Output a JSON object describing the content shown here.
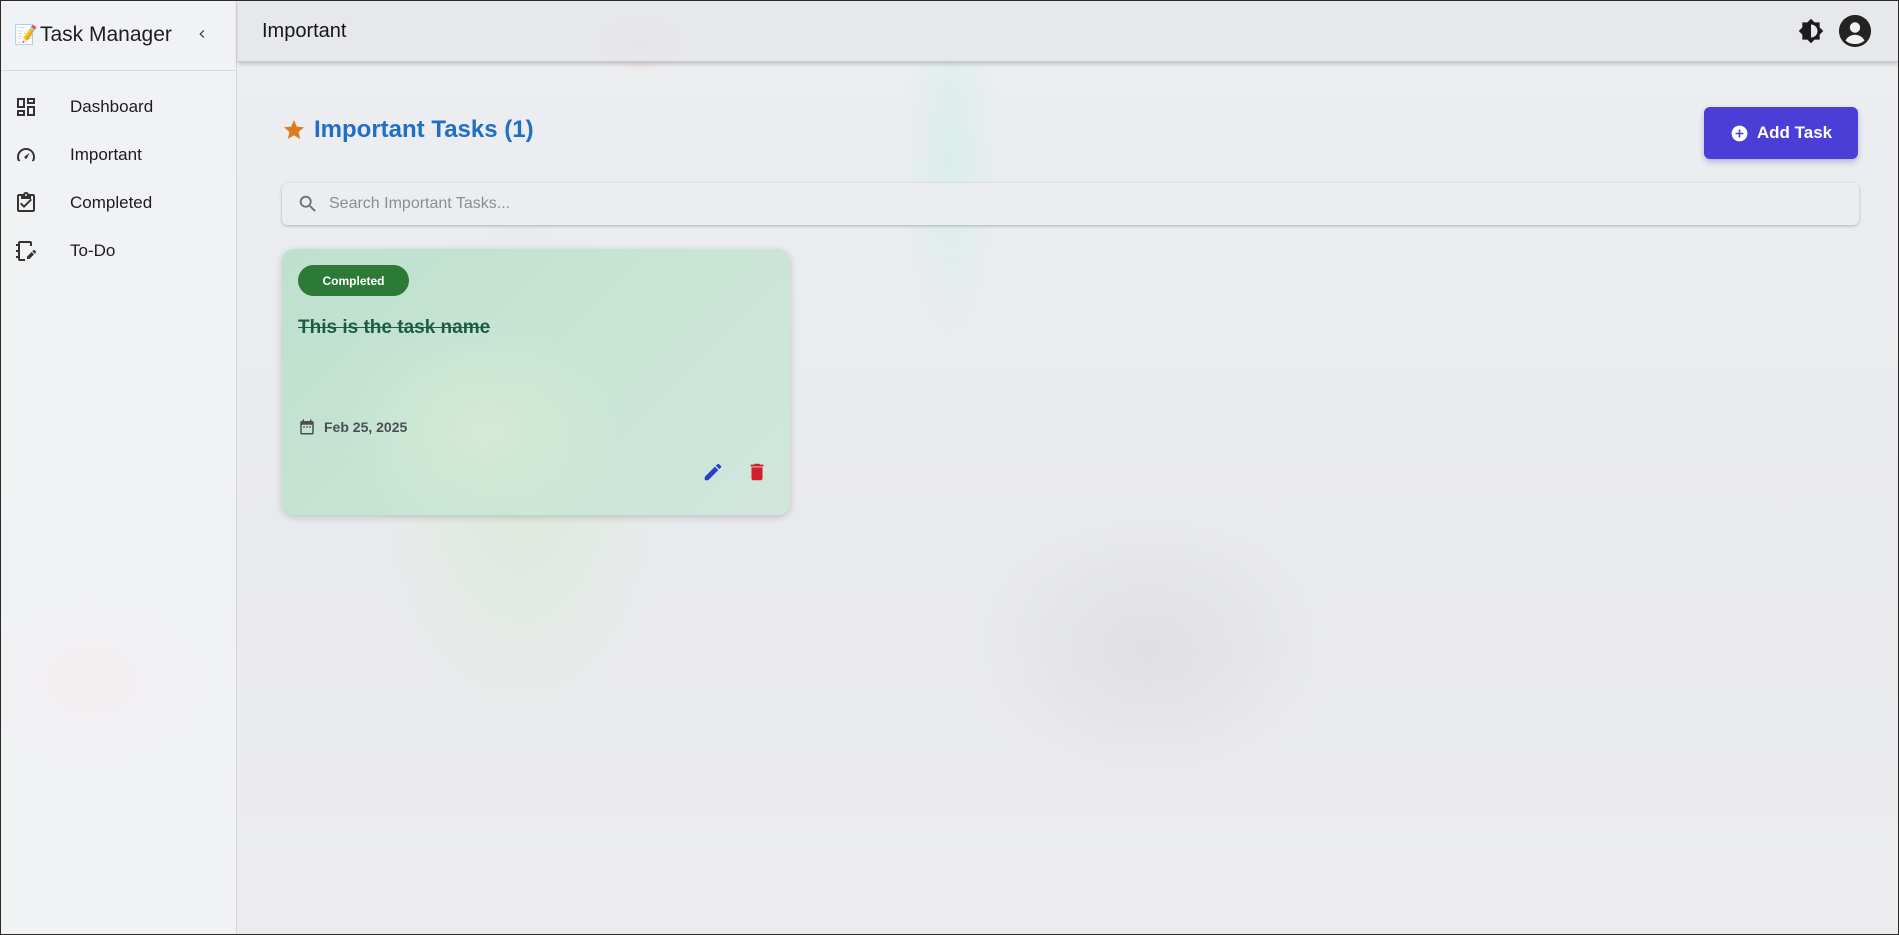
{
  "app": {
    "brand_emoji": "📝",
    "brand_title": "Task Manager"
  },
  "sidebar": {
    "items": [
      {
        "label": "Dashboard",
        "icon": "dashboard-icon"
      },
      {
        "label": "Important",
        "icon": "speedometer-icon"
      },
      {
        "label": "Completed",
        "icon": "clipboard-check-icon"
      },
      {
        "label": "To-Do",
        "icon": "notebook-edit-icon"
      }
    ]
  },
  "topbar": {
    "title": "Important"
  },
  "page": {
    "title": "Important Tasks (1)",
    "add_button_label": "Add Task",
    "search_placeholder": "Search Important Tasks..."
  },
  "tasks": [
    {
      "status": "Completed",
      "name": "This is the task name",
      "date": "Feb 25, 2025"
    }
  ],
  "colors": {
    "accent": "#4a3ed6",
    "title_blue": "#1f6fc4",
    "star": "#e07a1f",
    "completed_badge": "#2d7a37",
    "edit": "#2a3fc9",
    "delete": "#d11f2a"
  }
}
